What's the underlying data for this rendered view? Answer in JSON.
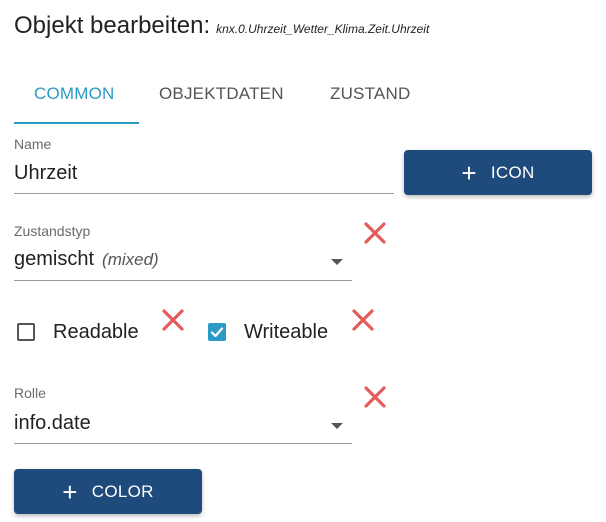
{
  "header": {
    "title": "Objekt bearbeiten:",
    "object_id": "knx.0.Uhrzeit_Wetter_Klima.Zeit.Uhrzeit"
  },
  "tabs": [
    {
      "label": "COMMON",
      "active": true
    },
    {
      "label": "OBJEKTDATEN",
      "active": false
    },
    {
      "label": "ZUSTAND",
      "active": false
    }
  ],
  "form": {
    "name": {
      "label": "Name",
      "value": "Uhrzeit"
    },
    "icon_button": {
      "label": "ICON",
      "icon": "plus-icon"
    },
    "state_type": {
      "label": "Zustandstyp",
      "value": "gemischt",
      "hint": "(mixed)",
      "clear_icon": "close-icon"
    },
    "readable": {
      "label": "Readable",
      "checked": false,
      "clear_icon": "close-icon"
    },
    "writeable": {
      "label": "Writeable",
      "checked": true,
      "clear_icon": "close-icon"
    },
    "role": {
      "label": "Rolle",
      "value": "info.date",
      "clear_icon": "close-icon"
    },
    "color_button": {
      "label": "COLOR",
      "icon": "plus-icon"
    }
  },
  "colors": {
    "accent": "#2b9bc6",
    "button": "#1e4a7c",
    "delete": "#e45b5b"
  }
}
